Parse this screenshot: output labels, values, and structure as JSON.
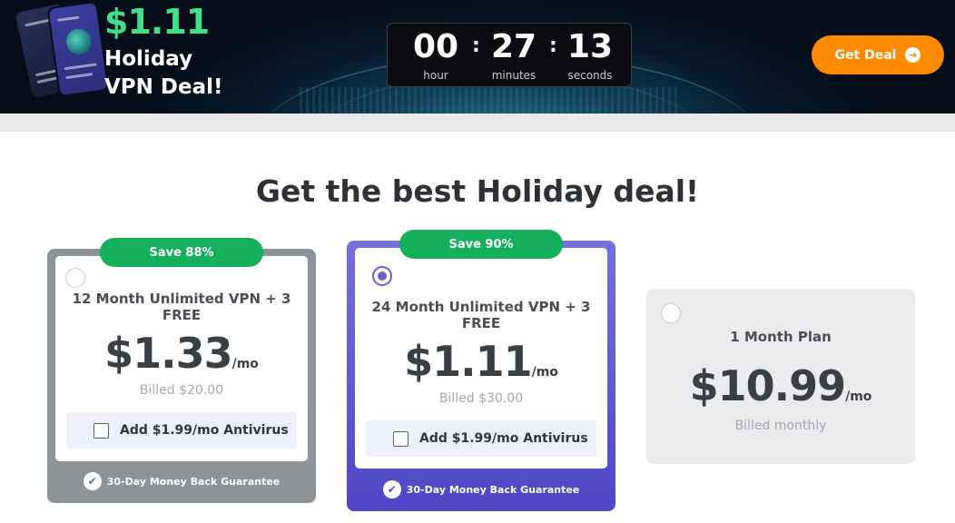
{
  "banner": {
    "promo_price": "$1.11",
    "promo_title_line1": "Holiday",
    "promo_title_line2": "VPN Deal!",
    "timer": {
      "hours": "00",
      "hours_label": "hour",
      "minutes": "27",
      "minutes_label": "minutes",
      "seconds": "13",
      "seconds_label": "seconds",
      "separator": ":"
    },
    "cta_label": "Get Deal",
    "cta_icon": "arrow-right-circle-icon",
    "colors": {
      "cta": "#ff8a00",
      "price": "#3ee08c"
    }
  },
  "headline": "Get the best Holiday deal!",
  "plans": [
    {
      "badge": "Save 88%",
      "name": "12 Month Unlimited VPN + 3 FREE",
      "price": "$1.33",
      "per": "/mo",
      "billed": "Billed $20.00",
      "addon": "Add $1.99/mo Antivirus",
      "guarantee": "30-Day Money Back Guarantee",
      "selected": false
    },
    {
      "badge": "Save 90%",
      "name": "24 Month Unlimited VPN + 3 FREE",
      "price": "$1.11",
      "per": "/mo",
      "billed": "Billed $30.00",
      "addon": "Add $1.99/mo Antivirus",
      "guarantee": "30-Day Money Back Guarantee",
      "selected": true
    },
    {
      "name": "1 Month Plan",
      "price": "$10.99",
      "per": "/mo",
      "billed": "Billed monthly",
      "selected": false
    }
  ],
  "colors": {
    "save_badge": "#14b05b",
    "selected_card": "#5a52c9",
    "unselected_card": "#8c9196"
  }
}
